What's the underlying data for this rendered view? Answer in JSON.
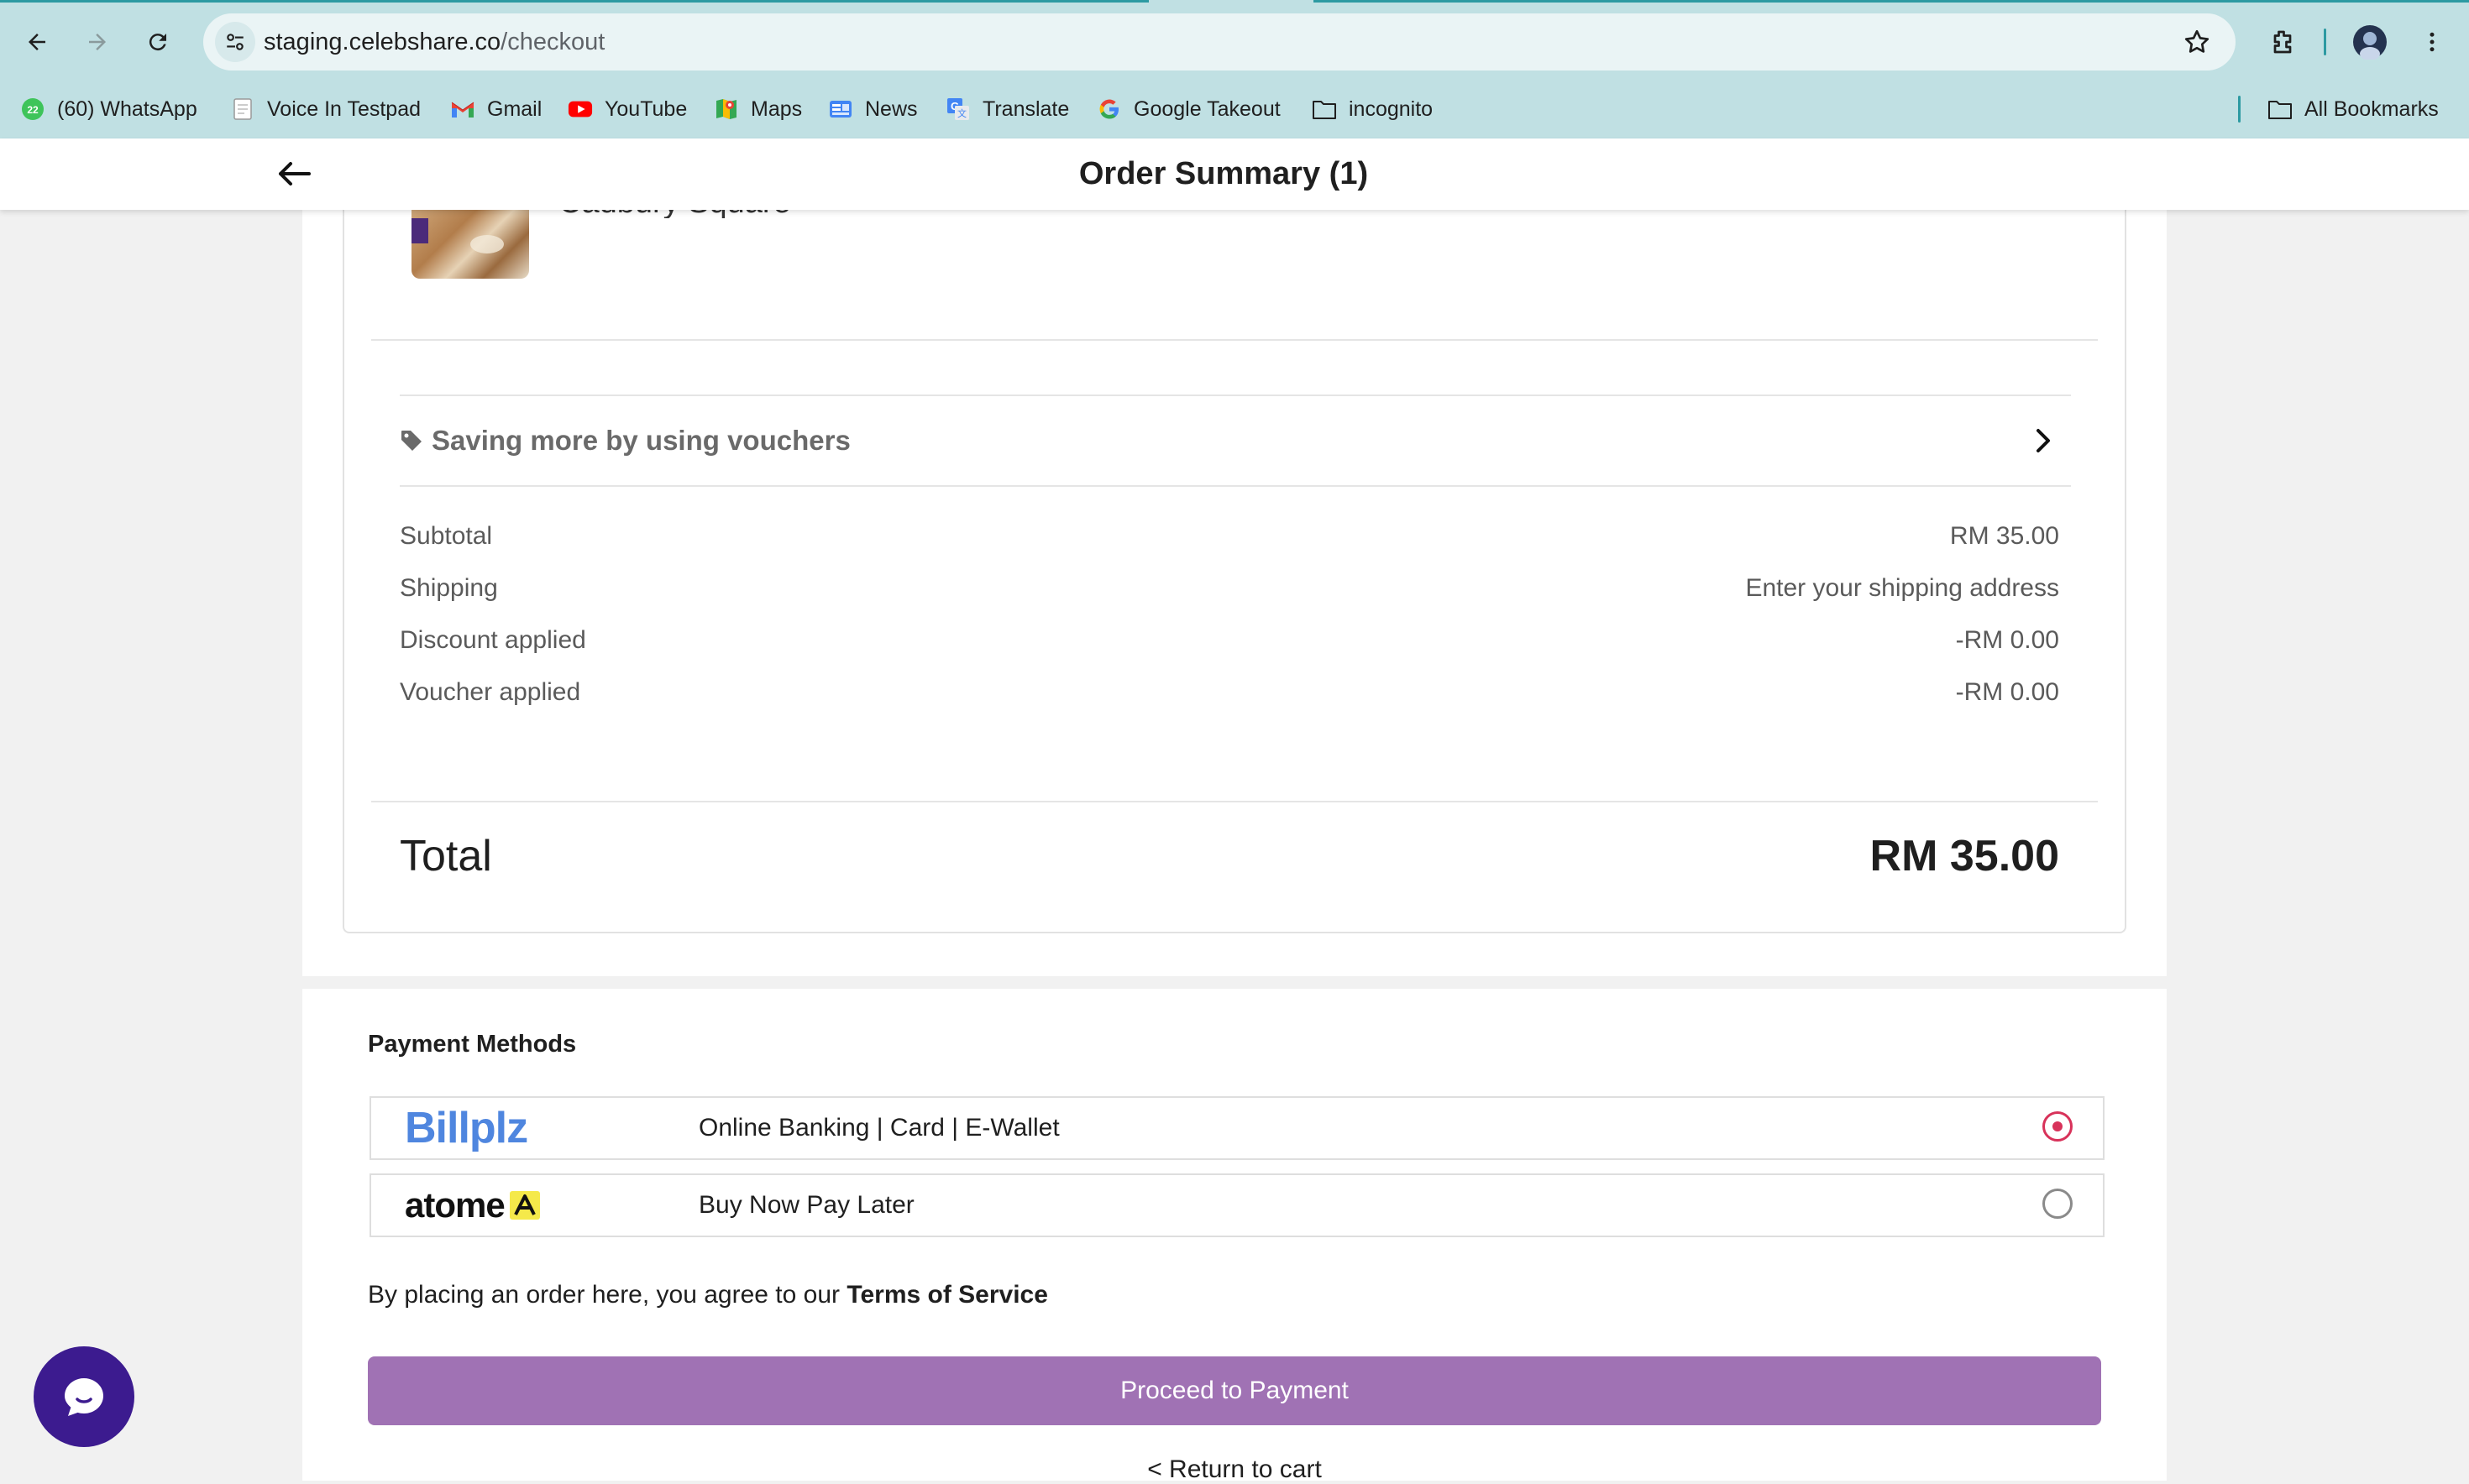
{
  "browser": {
    "url_host": "staging.celebshare.co",
    "url_path": "/checkout",
    "bookmarks": [
      {
        "label": "(60) WhatsApp",
        "icon": "whatsapp-icon",
        "badge": "22"
      },
      {
        "label": "Voice In Testpad",
        "icon": "notepad-icon"
      },
      {
        "label": "Gmail",
        "icon": "gmail-icon"
      },
      {
        "label": "YouTube",
        "icon": "youtube-icon"
      },
      {
        "label": "Maps",
        "icon": "maps-icon"
      },
      {
        "label": "News",
        "icon": "news-icon"
      },
      {
        "label": "Translate",
        "icon": "translate-icon"
      },
      {
        "label": "Google Takeout",
        "icon": "google-icon"
      },
      {
        "label": "incognito",
        "icon": "folder-icon"
      }
    ],
    "all_bookmarks": "All Bookmarks"
  },
  "header": {
    "title": "Order Summary (1)"
  },
  "product": {
    "name": "Cadbury Square"
  },
  "voucher": {
    "label": "Saving more by using vouchers"
  },
  "summary": {
    "lines": [
      {
        "label": "Subtotal",
        "value": "RM 35.00"
      },
      {
        "label": "Shipping",
        "value": "Enter your shipping address"
      },
      {
        "label": "Discount applied",
        "value": "-RM 0.00"
      },
      {
        "label": "Voucher applied",
        "value": "-RM 0.00"
      }
    ],
    "total_label": "Total",
    "total_value": "RM 35.00"
  },
  "payment": {
    "title": "Payment Methods",
    "methods": [
      {
        "logo_text": "Billplz",
        "description": "Online Banking | Card | E-Wallet",
        "selected": true
      },
      {
        "logo_text": "atome",
        "description": "Buy Now Pay Later",
        "selected": false
      }
    ],
    "terms_prefix": "By placing an order here, you agree to our ",
    "terms_link": "Terms of Service",
    "proceed_label": "Proceed to Payment",
    "return_label": "< Return to cart"
  },
  "colors": {
    "accent_button": "#a072b4",
    "radio_selected": "#d8325a",
    "billplz_blue": "#4f86df",
    "chat_purple": "#3c1b8f"
  }
}
